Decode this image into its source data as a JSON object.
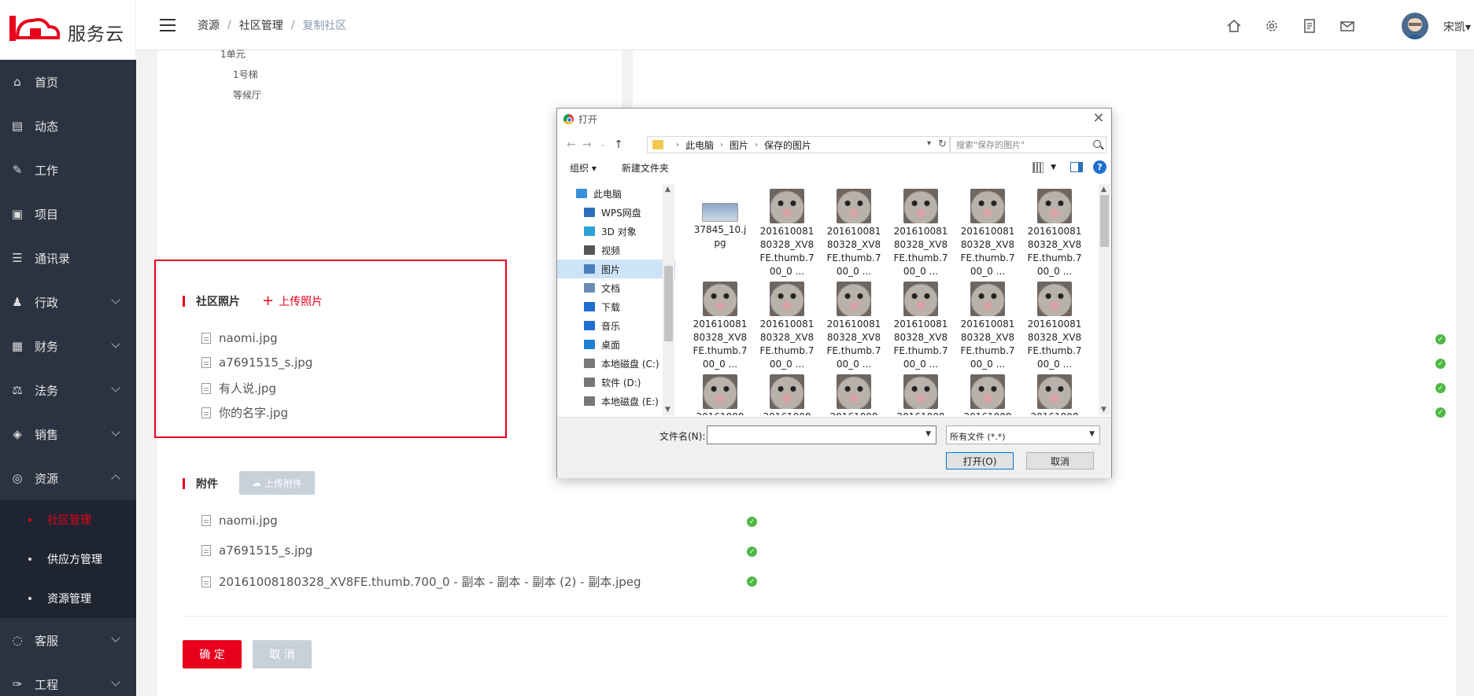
{
  "app": {
    "brand": "服务云"
  },
  "sidebar": {
    "items": [
      {
        "label": "首页",
        "icon": "home-icon",
        "arrow": false
      },
      {
        "label": "动态",
        "icon": "news-icon",
        "arrow": false
      },
      {
        "label": "工作",
        "icon": "task-icon",
        "arrow": false
      },
      {
        "label": "项目",
        "icon": "project-icon",
        "arrow": false
      },
      {
        "label": "通讯录",
        "icon": "contacts-icon",
        "arrow": false
      },
      {
        "label": "行政",
        "icon": "user-icon",
        "arrow": true
      },
      {
        "label": "财务",
        "icon": "finance-icon",
        "arrow": true
      },
      {
        "label": "法务",
        "icon": "law-icon",
        "arrow": true
      },
      {
        "label": "销售",
        "icon": "sales-icon",
        "arrow": true
      },
      {
        "label": "资源",
        "icon": "resource-icon",
        "arrow": true,
        "expanded": true
      }
    ],
    "sub_items": [
      {
        "label": "社区管理",
        "active": true
      },
      {
        "label": "供应方管理",
        "active": false
      },
      {
        "label": "资源管理",
        "active": false
      }
    ],
    "items_after": [
      {
        "label": "客服",
        "icon": "service-icon"
      },
      {
        "label": "工程",
        "icon": "wrench-icon"
      }
    ]
  },
  "header": {
    "breadcrumb": [
      "资源",
      "社区管理",
      "复制社区"
    ],
    "user_name": "宋凯"
  },
  "tree": {
    "items": [
      "1单元",
      "1号梯",
      "等候厅"
    ]
  },
  "photos": {
    "title": "社区照片",
    "upload_label": "上传照片",
    "files": [
      "naomi.jpg",
      "a7691515_s.jpg",
      "有人说.jpg",
      "你的名字.jpg"
    ]
  },
  "attachments": {
    "title": "附件",
    "upload_label": "上传附件",
    "files": [
      "naomi.jpg",
      "a7691515_s.jpg",
      "20161008180328_XV8FE.thumb.700_0 - 副本 - 副本 - 副本 (2) - 副本.jpeg"
    ]
  },
  "actions": {
    "confirm": "确 定",
    "cancel": "取 消"
  },
  "dialog": {
    "title": "打开",
    "path": [
      "此电脑",
      "图片",
      "保存的图片"
    ],
    "search_placeholder": "搜索\"保存的图片\"",
    "organize": "组织 ▾",
    "new_folder": "新建文件夹",
    "nav": [
      {
        "label": "此电脑",
        "color": "#3a8fd9",
        "root": true
      },
      {
        "label": "WPS网盘",
        "color": "#2a6ebb"
      },
      {
        "label": "3D 对象",
        "color": "#29a3d6"
      },
      {
        "label": "视频",
        "color": "#555"
      },
      {
        "label": "图片",
        "color": "#4a7fbf",
        "selected": true
      },
      {
        "label": "文档",
        "color": "#6b8cb5"
      },
      {
        "label": "下载",
        "color": "#1f6fd1"
      },
      {
        "label": "音乐",
        "color": "#1f6fd1"
      },
      {
        "label": "桌面",
        "color": "#1f7fd6"
      },
      {
        "label": "本地磁盘 (C:)",
        "color": "#777"
      },
      {
        "label": "软件 (D:)",
        "color": "#777"
      },
      {
        "label": "本地磁盘 (E:)",
        "color": "#777"
      }
    ],
    "files_row1": [
      "37845_10.jpg",
      "20161008180328_XV8FE.thumb.700_0 ...",
      "20161008180328_XV8FE.thumb.700_0 ...",
      "20161008180328_XV8FE.thumb.700_0 ...",
      "20161008180328_XV8FE.thumb.700_0 ...",
      "20161008180328_XV8FE.thumb.700_0 ..."
    ],
    "files_row2": [
      "20161008180328_XV8FE.thumb.700_0 ...",
      "20161008180328_XV8FE.thumb.700_0 ...",
      "20161008180328_XV8FE.thumb.700_0 ...",
      "20161008180328_XV8FE.thumb.700_0 ...",
      "20161008180328_XV8FE.thumb.700_0 ...",
      "20161008180328_XV8FE.thumb.700_0 ..."
    ],
    "files_row3": [
      "20161008",
      "20161008",
      "20161008",
      "20161008",
      "20161008",
      "20161008"
    ],
    "filename_label": "文件名(N):",
    "filename_value": "",
    "filetype": "所有文件 (*.*)",
    "open": "打开(O)",
    "cancel": "取消"
  },
  "colors": {
    "accent": "#e8001d",
    "sidebar": "#2b3340",
    "success": "#4fb845"
  }
}
